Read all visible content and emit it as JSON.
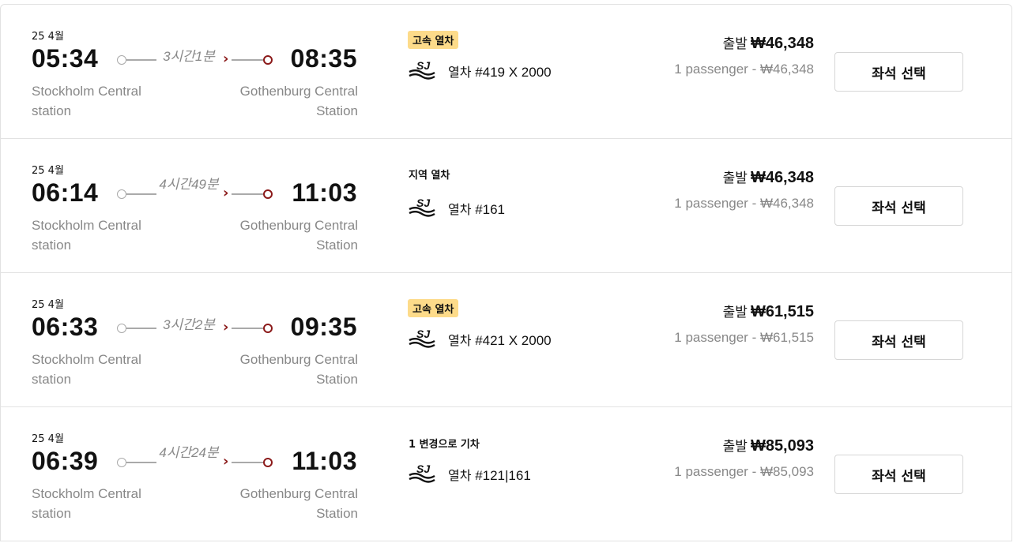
{
  "currency_prefix": "출발",
  "seat_button_label": "좌석 선택",
  "train_prefix": "열차",
  "results": [
    {
      "date": "25 4월",
      "departure_time": "05:34",
      "arrival_time": "08:35",
      "departure_station": "Stockholm Central station",
      "arrival_station": "Gothenburg Central Station",
      "duration": "3시간1분",
      "badge": "고속 열차",
      "badge_style": "highlight",
      "train_number": "#419 X 2000",
      "price": "₩46,348",
      "passenger_price": "1 passenger - ₩46,348"
    },
    {
      "date": "25 4월",
      "departure_time": "06:14",
      "arrival_time": "11:03",
      "departure_station": "Stockholm Central station",
      "arrival_station": "Gothenburg Central Station",
      "duration": "4시간49분",
      "badge": "지역 열차",
      "badge_style": "plain",
      "train_number": "#161",
      "price": "₩46,348",
      "passenger_price": "1 passenger - ₩46,348"
    },
    {
      "date": "25 4월",
      "departure_time": "06:33",
      "arrival_time": "09:35",
      "departure_station": "Stockholm Central station",
      "arrival_station": "Gothenburg Central Station",
      "duration": "3시간2분",
      "badge": "고속 열차",
      "badge_style": "highlight",
      "train_number": "#421 X 2000",
      "price": "₩61,515",
      "passenger_price": "1 passenger - ₩61,515"
    },
    {
      "date": "25 4월",
      "departure_time": "06:39",
      "arrival_time": "11:03",
      "departure_station": "Stockholm Central station",
      "arrival_station": "Gothenburg Central Station",
      "duration": "4시간24분",
      "badge": "1 변경으로 기차",
      "badge_style": "plain",
      "train_number": "#121|161",
      "price": "₩85,093",
      "passenger_price": "1 passenger - ₩85,093"
    }
  ],
  "icons": {
    "operator_logo": "sj-logo-icon",
    "route_arrow": "chevron-right-icon"
  },
  "colors": {
    "badge_highlight": "#fddb8a",
    "route_accent": "#8b1a1a",
    "muted_text": "#888888"
  }
}
